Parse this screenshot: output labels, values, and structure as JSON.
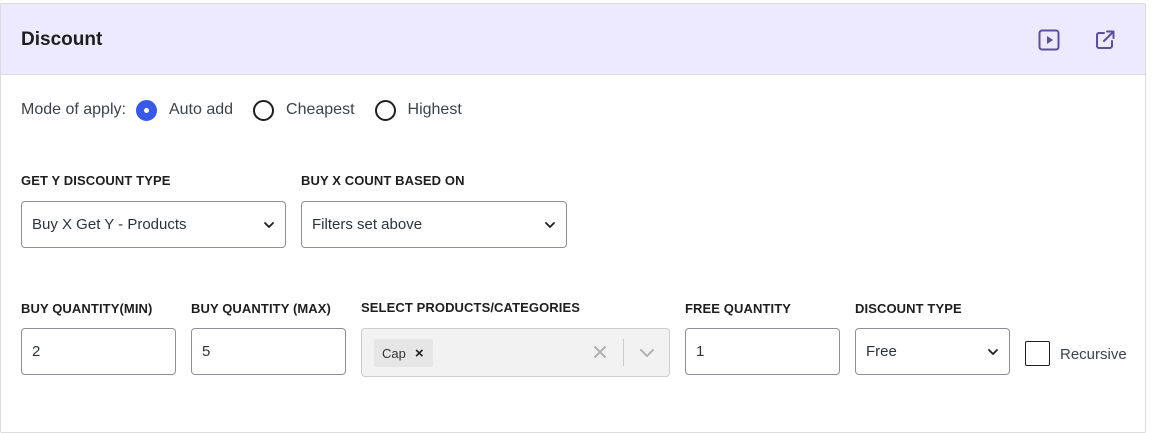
{
  "panel": {
    "title": "Discount",
    "icons": [
      "play-video-icon",
      "external-link-icon"
    ]
  },
  "mode": {
    "label": "Mode of apply:",
    "options": [
      {
        "label": "Auto add",
        "checked": true
      },
      {
        "label": "Cheapest",
        "checked": false
      },
      {
        "label": "Highest",
        "checked": false
      }
    ]
  },
  "get_y_discount_type": {
    "label": "GET Y DISCOUNT TYPE",
    "value": "Buy X Get Y - Products"
  },
  "buy_x_count_based_on": {
    "label": "BUY X COUNT BASED ON",
    "value": "Filters set above"
  },
  "buy_qty_min": {
    "label": "BUY QUANTITY(MIN)",
    "value": "2"
  },
  "buy_qty_max": {
    "label": "BUY QUANTITY (MAX)",
    "value": "5"
  },
  "select_products": {
    "label": "SELECT PRODUCTS/CATEGORIES",
    "tags": [
      "Cap"
    ],
    "tag_remove": "×"
  },
  "free_quantity": {
    "label": "FREE QUANTITY",
    "value": "1"
  },
  "discount_type": {
    "label": "DISCOUNT TYPE",
    "value": "Free"
  },
  "recursive": {
    "label": "Recursive",
    "checked": false
  },
  "colors": {
    "header_bg": "#ede9fe",
    "accent": "#3858e9",
    "icon": "#5b4fa0"
  }
}
